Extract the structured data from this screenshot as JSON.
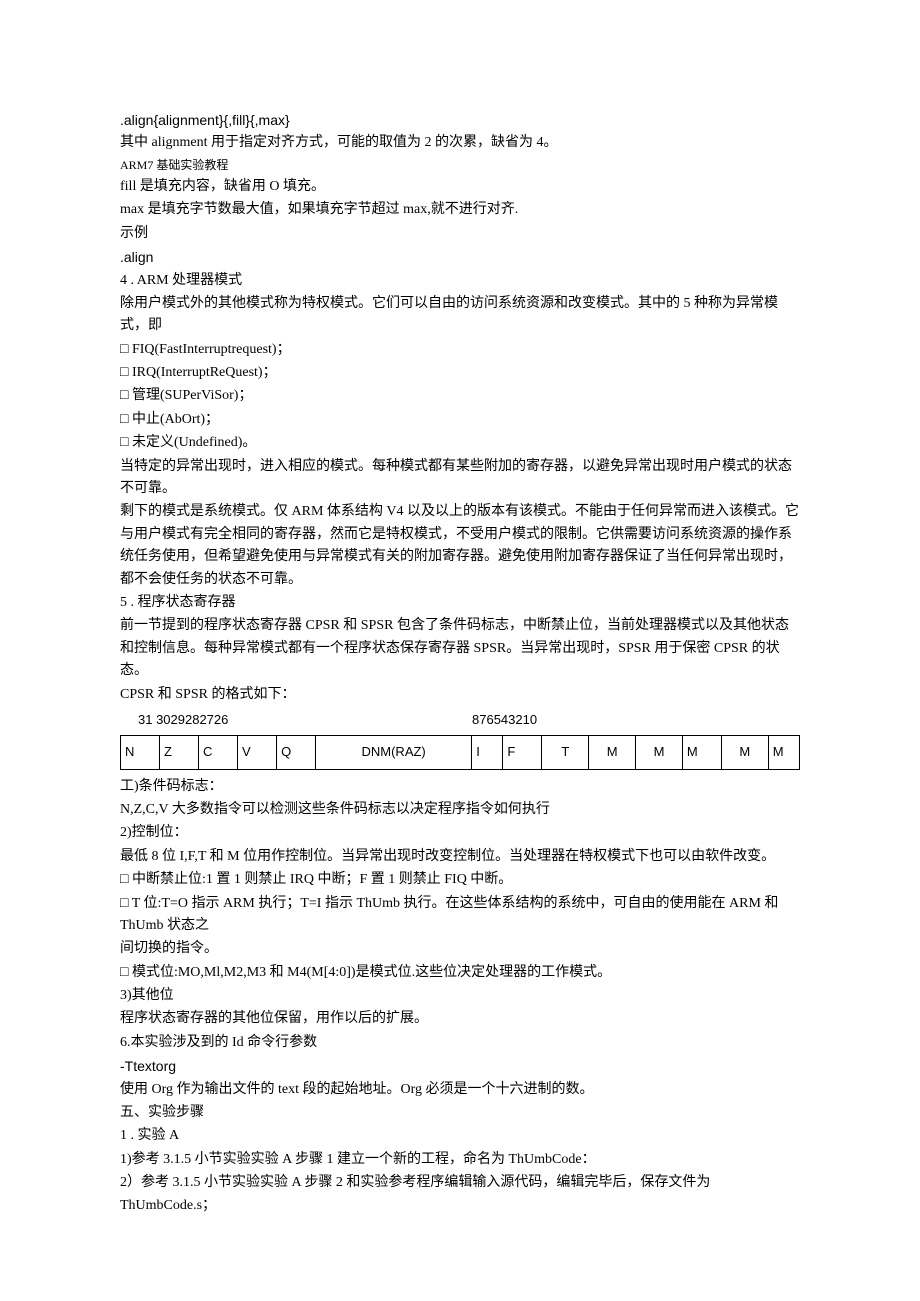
{
  "p1": ".align{alignment}{,fill}{,max}",
  "p2": "其中 alignment 用于指定对齐方式，可能的取值为 2 的次累，缺省为 4。",
  "p3": "ARM7 基础实验教程",
  "p4": "fill 是填充内容，缺省用 O 填充。",
  "p5": "max 是填充字节数最大值，如果填充字节超过 max,就不进行对齐.",
  "p6": "示例",
  "p7": ".align",
  "p8": "4 . ARM 处理器模式",
  "p9": "除用户模式外的其他模式称为特权模式。它们可以自由的访问系统资源和改变模式。其中的 5 种称为异常模式，即",
  "p10": "□ FIQ(FastInterruptrequest)；",
  "p11": "□ IRQ(InterruptReQuest)；",
  "p12": "□ 管理(SUPerViSor)；",
  "p13": "□ 中止(AbOrt)；",
  "p14": "□ 未定义(Undefined)。",
  "p15": "当特定的异常出现时，进入相应的模式。每种模式都有某些附加的寄存器，以避免异常出现时用户模式的状态不可靠。",
  "p16": "剩下的模式是系统模式。仅 ARM 体系结构 V4 以及以上的版本有该模式。不能由于任何异常而进入该模式。它与用户模式有完全相同的寄存器，然而它是特权模式，不受用户模式的限制。它供需要访问系统资源的操作系统任务使用，但希望避免使用与异常模式有关的附加寄存器。避免使用附加寄存器保证了当任何异常出现时，都不会使任务的状态不可靠。",
  "p17": "5 . 程序状态寄存器",
  "p18": "前一节提到的程序状态寄存器 CPSR 和 SPSR 包含了条件码标志，中断禁止位，当前处理器模式以及其他状态和控制信息。每种异常模式都有一个程序状态保存寄存器 SPSR。当异常出现时，SPSR 用于保密 CPSR 的状态。",
  "p19": "CPSR 和 SPSR 的格式如下：",
  "hdr_left": "31      3029282726",
  "hdr_right": "876543210",
  "table": [
    "N",
    "Z",
    "C",
    "V",
    "Q",
    "DNM(RAZ)",
    "I",
    "F",
    "T",
    "M",
    "M",
    "M",
    "M",
    "M"
  ],
  "p20": "工)条件码标志：",
  "p21": "N,Z,C,V 大多数指令可以检测这些条件码标志以决定程序指令如何执行",
  "p22": "2)控制位：",
  "p23": "最低 8 位 I,F,T 和 M 位用作控制位。当异常出现时改变控制位。当处理器在特权模式下也可以由软件改变。",
  "p24": "□ 中断禁止位:1 置 1 则禁止 IRQ 中断；F 置 1 则禁止 FIQ 中断。",
  "p25": "□ T 位:T=O 指示 ARM 执行；T=I 指示 ThUmb 执行。在这些体系结构的系统中，可自由的使用能在 ARM 和 ThUmb 状态之",
  "p26": "间切换的指令。",
  "p27": "□ 模式位:MO,Ml,M2,M3 和 M4(M[4:0])是模式位.这些位决定处理器的工作模式。",
  "p28": "3)其他位",
  "p29": "程序状态寄存器的其他位保留，用作以后的扩展。",
  "p30": "6.本实验涉及到的 Id 命令行参数",
  "p31": "-Ttextorg",
  "p32": "使用 Org 作为输出文件的 text 段的起始地址。Org 必须是一个十六进制的数。",
  "p33": "五、实验步骤",
  "p34": "1 . 实验 A",
  "p35": "1)参考 3.1.5 小节实验实验 A 步骤 1 建立一个新的工程，命名为 ThUmbCode：",
  "p36": "2）参考 3.1.5 小节实验实验 A 步骤 2 和实验参考程序编辑输入源代码，编辑完毕后，保存文件为 ThUmbCode.s；"
}
